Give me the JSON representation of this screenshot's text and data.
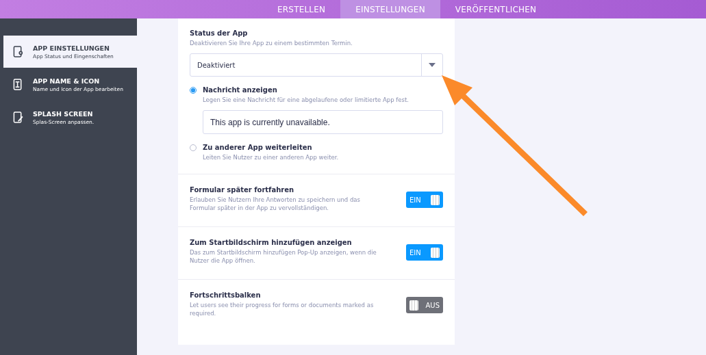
{
  "tabs": [
    {
      "label": "ERSTELLEN",
      "selected": false
    },
    {
      "label": "EINSTELLUNGEN",
      "selected": true
    },
    {
      "label": "VERÖFFENTLICHEN",
      "selected": false
    }
  ],
  "sidebar": {
    "items": [
      {
        "title": "APP EINSTELLUNGEN",
        "subtitle": "App Status und Eingenschaften",
        "selected": true
      },
      {
        "title": "APP NAME & ICON",
        "subtitle": "Name und Icon der App bearbeiten",
        "selected": false
      },
      {
        "title": "SPLASH SCREEN",
        "subtitle": "Splas-Screen anpassen.",
        "selected": false
      }
    ]
  },
  "status": {
    "title": "Status der App",
    "description": "Deaktivieren Sie Ihre App zu einem bestimmten Termin.",
    "dropdown_value": "Deaktiviert",
    "options": [
      {
        "label": "Nachricht anzeigen",
        "description": "Legen Sie eine Nachricht für eine abgelaufene oder limitierte App fest.",
        "selected": true,
        "message": "This app is currently unavailable."
      },
      {
        "label": "Zu anderer App weiterleiten",
        "description": "Leiten Sie Nutzer zu einer anderen App weiter.",
        "selected": false
      }
    ]
  },
  "settings": [
    {
      "title": "Formular später fortfahren",
      "description": "Erlauben Sie Nutzern Ihre Antworten zu speichern und das Formular später in der App zu vervollständigen.",
      "on": true,
      "toggle_label": "EIN"
    },
    {
      "title": "Zum Startbildschirm hinzufügen anzeigen",
      "description": "Das zum Startbildschirm hinzufügen Pop-Up anzeigen, wenn die Nutzer die App öffnen.",
      "on": true,
      "toggle_label": "EIN"
    },
    {
      "title": "Fortschrittsbalken",
      "description": "Let users see their progress for forms or documents marked as required.",
      "on": false,
      "toggle_label": "AUS"
    }
  ]
}
